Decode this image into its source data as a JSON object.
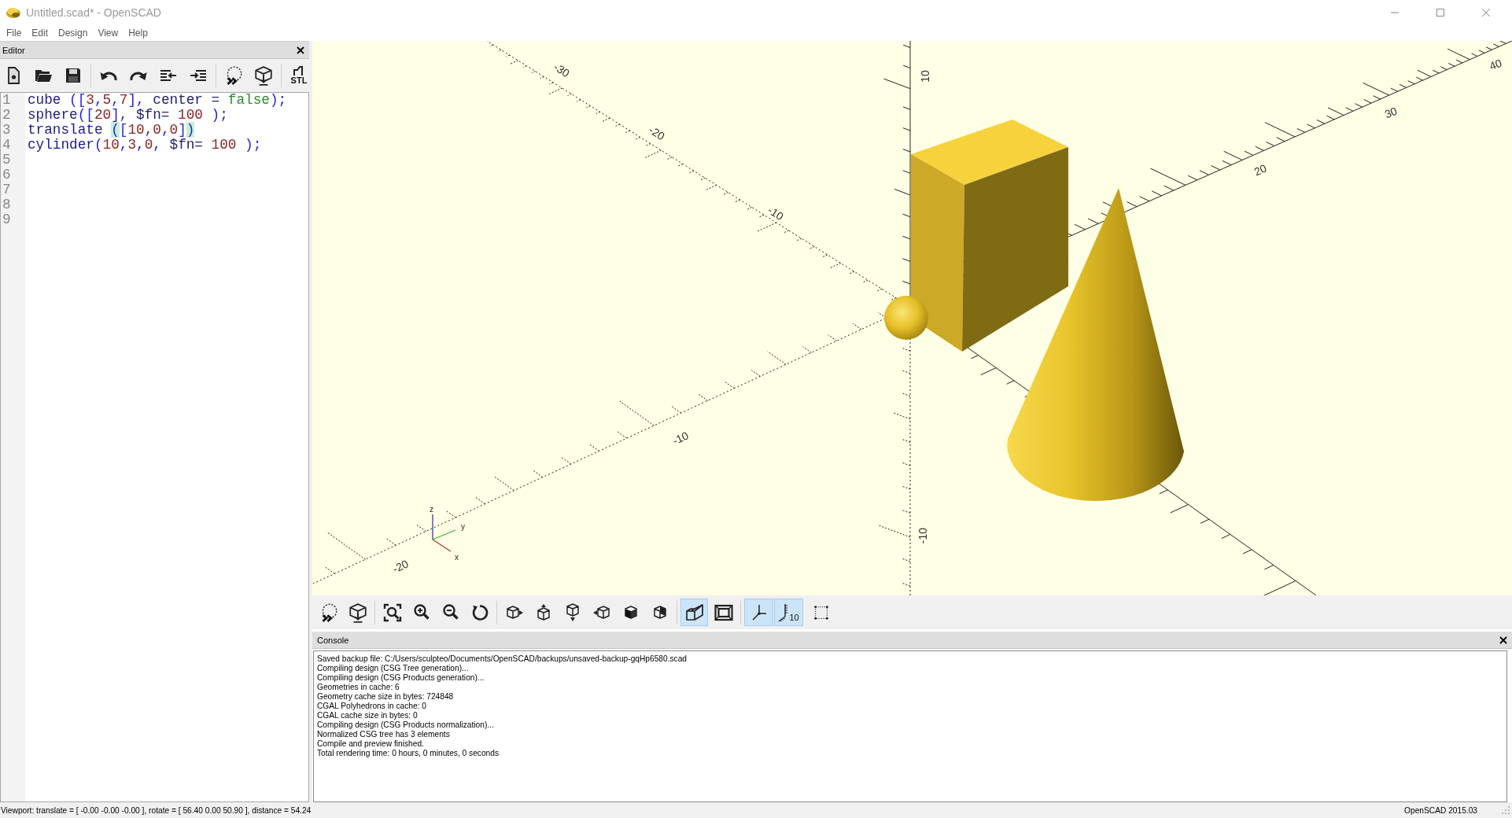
{
  "window": {
    "title": "Untitled.scad* - OpenSCAD"
  },
  "menu": [
    "File",
    "Edit",
    "Design",
    "View",
    "Help"
  ],
  "editor": {
    "title": "Editor",
    "export_label": "STL",
    "line_numbers": [
      "1",
      "2",
      "3",
      "4",
      "5",
      "6",
      "7",
      "8",
      "9"
    ],
    "lines": [
      {
        "tokens": [
          {
            "kind": "keyword",
            "text": "cube"
          },
          {
            "kind": "punct",
            "text": " (["
          },
          {
            "kind": "number",
            "text": "3"
          },
          {
            "kind": "punct",
            "text": ","
          },
          {
            "kind": "number",
            "text": "5"
          },
          {
            "kind": "punct",
            "text": ","
          },
          {
            "kind": "number",
            "text": "7"
          },
          {
            "kind": "punct",
            "text": "],"
          },
          {
            "kind": "name",
            "text": " center = "
          },
          {
            "kind": "bool",
            "text": "false"
          },
          {
            "kind": "punct",
            "text": ");"
          }
        ]
      },
      {
        "tokens": [
          {
            "kind": "keyword",
            "text": "sphere"
          },
          {
            "kind": "punct",
            "text": "(["
          },
          {
            "kind": "number",
            "text": "20"
          },
          {
            "kind": "punct",
            "text": "],"
          },
          {
            "kind": "name",
            "text": " $fn= "
          },
          {
            "kind": "number",
            "text": "100"
          },
          {
            "kind": "punct",
            "text": " );"
          }
        ]
      },
      {
        "tokens": [
          {
            "kind": "keyword",
            "text": "translate ",
            "matched": false
          },
          {
            "kind": "punct",
            "text": "(",
            "matched": true
          },
          {
            "kind": "punct",
            "text": "[",
            "matched": false
          },
          {
            "kind": "number",
            "text": "10",
            "matched": false
          },
          {
            "kind": "punct",
            "text": ",",
            "matched": false
          },
          {
            "kind": "number",
            "text": "0",
            "matched": false
          },
          {
            "kind": "punct",
            "text": ",",
            "matched": false
          },
          {
            "kind": "number",
            "text": "0",
            "matched": false
          },
          {
            "kind": "punct",
            "text": "]",
            "matched": false
          },
          {
            "kind": "punct",
            "text": ")",
            "matched": true
          }
        ]
      },
      {
        "tokens": [
          {
            "kind": "keyword",
            "text": "cylinder"
          },
          {
            "kind": "punct",
            "text": "("
          },
          {
            "kind": "number",
            "text": "10"
          },
          {
            "kind": "punct",
            "text": ","
          },
          {
            "kind": "number",
            "text": "3"
          },
          {
            "kind": "punct",
            "text": ","
          },
          {
            "kind": "number",
            "text": "0"
          },
          {
            "kind": "punct",
            "text": ","
          },
          {
            "kind": "name",
            "text": " $fn= "
          },
          {
            "kind": "number",
            "text": "100"
          },
          {
            "kind": "punct",
            "text": " );"
          }
        ]
      }
    ]
  },
  "viewport": {
    "scale_labels": [
      "-30",
      "-20",
      "-10",
      "-10",
      "-20",
      "-10",
      "20",
      "30",
      "40",
      "10"
    ],
    "gizmo_labels": [
      "z",
      "y",
      "x"
    ]
  },
  "view_toolbar": {
    "projection": [
      {
        "selected": true
      },
      {
        "selected": false
      }
    ],
    "toggles": [
      {
        "selected": true
      },
      {
        "selected": true,
        "label": "10"
      },
      {
        "selected": false
      }
    ]
  },
  "console": {
    "title": "Console",
    "lines": [
      "Saved backup file: C:/Users/sculpteo/Documents/OpenSCAD/backups/unsaved-backup-gqHp6580.scad",
      "Compiling design (CSG Tree generation)...",
      "Compiling design (CSG Products generation)...",
      "Geometries in cache: 6",
      "Geometry cache size in bytes: 724848",
      "CGAL Polyhedrons in cache: 0",
      "CGAL cache size in bytes: 0",
      "Compiling design (CSG Products normalization)...",
      "Normalized CSG tree has 3 elements",
      "Compile and preview finished.",
      "Total rendering time: 0 hours, 0 minutes, 0 seconds"
    ]
  },
  "status_bar": {
    "viewport": "Viewport: translate = [ -0.00 -0.00 -0.00 ], rotate = [ 56.40 0.00 50.90 ], distance = 54.24",
    "version": "OpenSCAD 2015.03"
  }
}
